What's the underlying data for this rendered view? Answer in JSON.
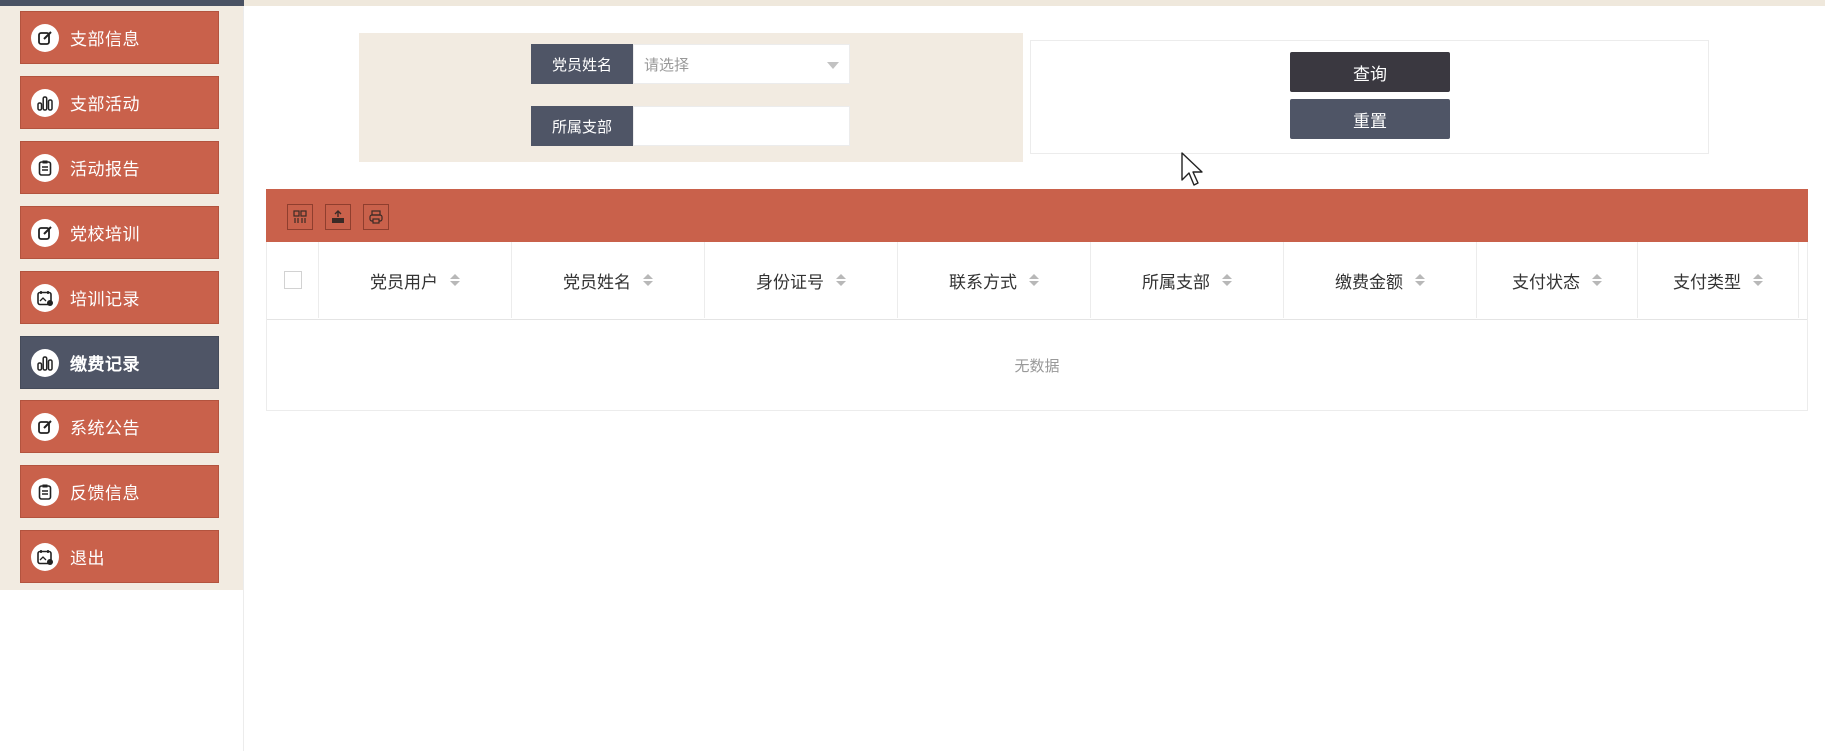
{
  "sidebar": {
    "items": [
      {
        "label": "支部信息",
        "icon": "edit-icon",
        "active": false
      },
      {
        "label": "支部活动",
        "icon": "bar-chart-icon",
        "active": false
      },
      {
        "label": "活动报告",
        "icon": "clipboard-icon",
        "active": false
      },
      {
        "label": "党校培训",
        "icon": "edit-icon",
        "active": false
      },
      {
        "label": "培训记录",
        "icon": "calendar-icon",
        "active": false
      },
      {
        "label": "缴费记录",
        "icon": "bar-chart-icon",
        "active": true
      },
      {
        "label": "系统公告",
        "icon": "edit-icon",
        "active": false
      },
      {
        "label": "反馈信息",
        "icon": "clipboard-icon",
        "active": false
      },
      {
        "label": "退出",
        "icon": "calendar-icon",
        "active": false
      }
    ]
  },
  "search": {
    "name_label": "党员姓名",
    "name_placeholder": "请选择",
    "branch_label": "所属支部",
    "branch_value": ""
  },
  "buttons": {
    "query": "查询",
    "reset": "重置"
  },
  "toolbar": {
    "icons": [
      "columns-icon",
      "export-icon",
      "print-icon"
    ]
  },
  "table": {
    "columns": [
      "党员用户",
      "党员姓名",
      "身份证号",
      "联系方式",
      "所属支部",
      "缴费金额",
      "支付状态",
      "支付类型"
    ],
    "empty_text": "无数据"
  },
  "colors": {
    "accent": "#c9614b",
    "dark": "#4f5566",
    "query_button": "#3a3840",
    "panel_bg": "#f2ebe1"
  }
}
